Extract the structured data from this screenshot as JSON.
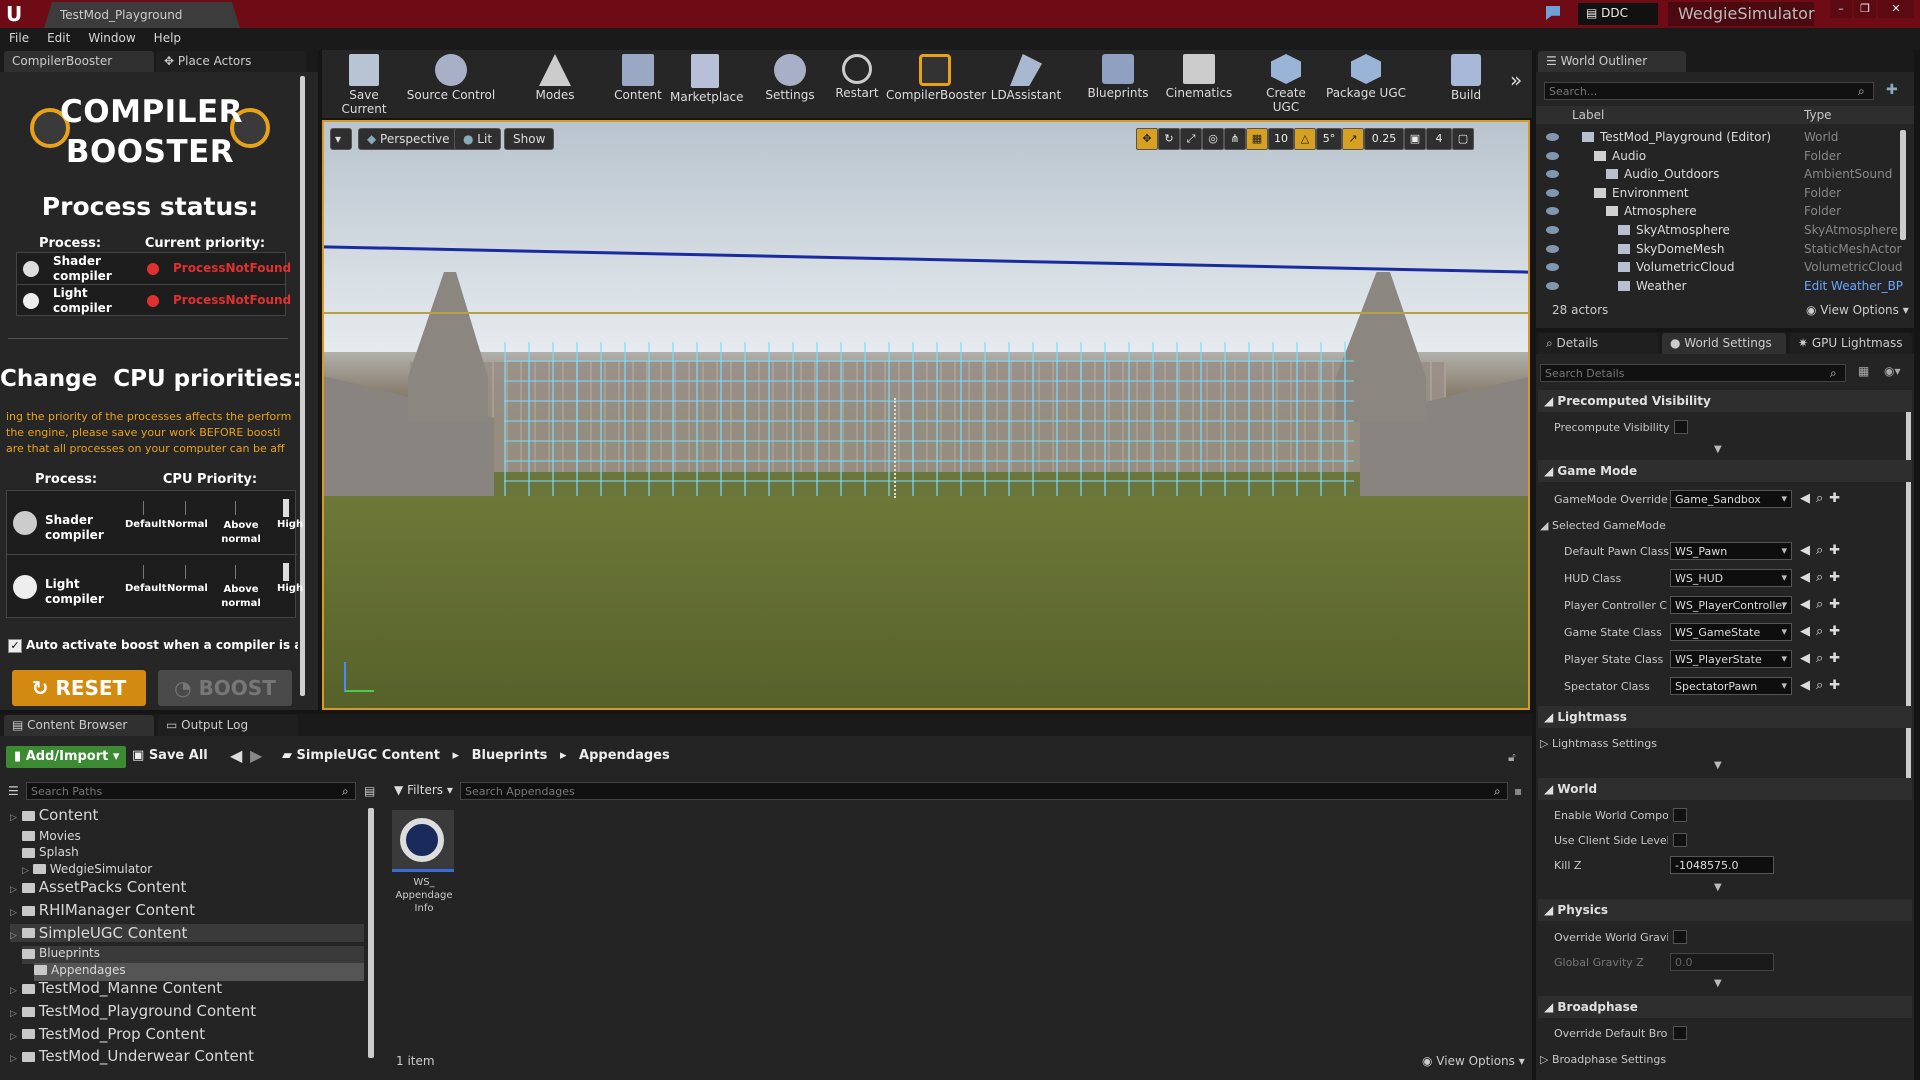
{
  "window": {
    "tab": "TestMod_Playground",
    "ddc": "DDC",
    "project": "WedgieSimulator"
  },
  "menu": [
    "File",
    "Edit",
    "Window",
    "Help"
  ],
  "left_tabs": [
    "CompilerBooster",
    "Place Actors"
  ],
  "booster": {
    "title_line1": "COMPILER",
    "title_line2": "BOOSTER",
    "status_heading": "Process status:",
    "col_process": "Process:",
    "col_priority": "Current priority:",
    "status_rows": [
      {
        "name": "Shader compiler",
        "status": "ProcessNotFound"
      },
      {
        "name": "Light compiler",
        "status": "ProcessNotFound"
      }
    ],
    "cpu_heading": "Change  CPU priorities:",
    "warning": [
      "ing the priority of the processes affects the perform",
      "the engine, please save your work BEFORE boosti",
      "are that all processes on your computer can be aff"
    ],
    "col_process2": "Process:",
    "col_cpu": "CPU Priority:",
    "cpu_rows": [
      {
        "name": "Shader compiler"
      },
      {
        "name": "Light compiler"
      }
    ],
    "levels": [
      "Default",
      "Normal",
      "Above normal",
      "High"
    ],
    "auto_label": "Auto activate boost when a compiler is availabl",
    "reset": "RESET",
    "boost": "BOOST"
  },
  "toolbar": [
    "Save Current",
    "Source Control",
    "Modes",
    "Content",
    "Marketplace",
    "Settings",
    "Restart",
    "CompilerBooster",
    "LDAssistant",
    "Blueprints",
    "Cinematics",
    "Create UGC",
    "Package UGC",
    "Build"
  ],
  "viewport": {
    "perspective": "Perspective",
    "lit": "Lit",
    "show": "Show",
    "grid": "10",
    "rot": "5°",
    "scale": "0.25",
    "cam": "4"
  },
  "outliner": {
    "tab": "World Outliner",
    "search": "Search...",
    "col_label": "Label",
    "col_type": "Type",
    "rows": [
      {
        "label": "TestMod_Playground (Editor)",
        "type": "World",
        "indent": 0
      },
      {
        "label": "Audio",
        "type": "Folder",
        "indent": 1
      },
      {
        "label": "Audio_Outdoors",
        "type": "AmbientSound",
        "indent": 2
      },
      {
        "label": "Environment",
        "type": "Folder",
        "indent": 1
      },
      {
        "label": "Atmosphere",
        "type": "Folder",
        "indent": 2
      },
      {
        "label": "SkyAtmosphere",
        "type": "SkyAtmosphere",
        "indent": 3
      },
      {
        "label": "SkyDomeMesh",
        "type": "StaticMeshActor",
        "indent": 3
      },
      {
        "label": "VolumetricCloud",
        "type": "VolumetricCloud",
        "indent": 3
      },
      {
        "label": "Weather",
        "type": "Edit Weather_BP",
        "indent": 3
      }
    ],
    "count": "28 actors",
    "view_options": "View Options"
  },
  "details": {
    "tabs": [
      "Details",
      "World Settings",
      "GPU Lightmass"
    ],
    "search": "Search Details",
    "sections": {
      "precomputed": "Precomputed Visibility",
      "precompute_vis": "Precompute Visibility",
      "gamemode": "Game Mode",
      "gm_override": "GameMode Override",
      "gm_override_val": "Game_Sandbox",
      "selected_gm": "Selected GameMode",
      "pawn": "Default Pawn Class",
      "pawn_val": "WS_Pawn",
      "hud": "HUD Class",
      "hud_val": "WS_HUD",
      "pc": "Player Controller Cla",
      "pc_val": "WS_PlayerController",
      "gs": "Game State Class",
      "gs_val": "WS_GameState",
      "ps": "Player State Class",
      "ps_val": "WS_PlayerState",
      "spec": "Spectator Class",
      "spec_val": "SpectatorPawn",
      "lightmass": "Lightmass",
      "lightmass_settings": "Lightmass Settings",
      "world": "World",
      "enable_wc": "Enable World Composi",
      "client_lvl": "Use Client Side Level S",
      "killz": "Kill Z",
      "killz_val": "-1048575.0",
      "physics": "Physics",
      "override_grav": "Override World Gravity",
      "global_grav": "Global Gravity Z",
      "global_grav_val": "0.0",
      "broadphase": "Broadphase",
      "override_broad": "Override Default Broad",
      "broad_settings": "Broadphase Settings"
    }
  },
  "content": {
    "tabs": [
      "Content Browser",
      "Output Log"
    ],
    "add": "Add/Import",
    "save": "Save All",
    "crumbs": [
      "SimpleUGC Content",
      "Blueprints",
      "Appendages"
    ],
    "search_paths": "Search Paths",
    "filters": "Filters",
    "search_assets": "Search Appendages",
    "tree": [
      {
        "label": "Content",
        "level": 0,
        "big": true
      },
      {
        "label": "Movies",
        "level": 1,
        "big": false
      },
      {
        "label": "Splash",
        "level": 1,
        "big": false
      },
      {
        "label": "WedgieSimulator",
        "level": 1,
        "big": false
      },
      {
        "label": "AssetPacks Content",
        "level": 0,
        "big": true
      },
      {
        "label": "RHIManager Content",
        "level": 0,
        "big": true
      },
      {
        "label": "SimpleUGC Content",
        "level": 0,
        "big": true
      },
      {
        "label": "Blueprints",
        "level": 1,
        "big": false
      },
      {
        "label": "Appendages",
        "level": 2,
        "big": false
      },
      {
        "label": "TestMod_Manne Content",
        "level": 0,
        "big": true
      },
      {
        "label": "TestMod_Playground Content",
        "level": 0,
        "big": true
      },
      {
        "label": "TestMod_Prop Content",
        "level": 0,
        "big": true
      },
      {
        "label": "TestMod_Underwear Content",
        "level": 0,
        "big": true
      }
    ],
    "asset_name": "WS_ Appendage Info",
    "count": "1 item",
    "view_options": "View Options"
  },
  "colors": {
    "title": "#6e0b14",
    "accent": "#e8a21a",
    "error": "#e03030",
    "reset": "#d28a10"
  }
}
